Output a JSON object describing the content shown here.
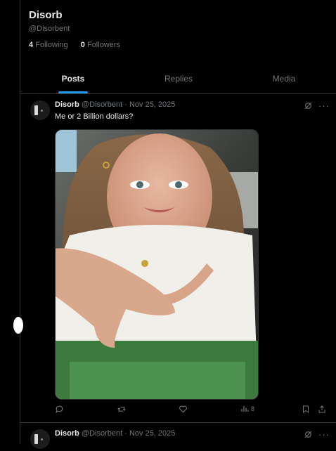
{
  "profile": {
    "name": "Disorb",
    "handle": "@Disorbent",
    "following_count": "4",
    "following_label": "Following",
    "followers_count": "0",
    "followers_label": "Followers"
  },
  "tabs": [
    {
      "label": "Posts",
      "active": true
    },
    {
      "label": "Replies",
      "active": false
    },
    {
      "label": "Media",
      "active": false
    }
  ],
  "posts": [
    {
      "name": "Disorb",
      "handle": "@Disorbent",
      "separator": "·",
      "date": "Nov 25, 2025",
      "text": "Me or 2 Billion dollars?",
      "views": "8",
      "has_image": true
    },
    {
      "name": "Disorb",
      "handle": "@Disorbent",
      "separator": "·",
      "date": "Nov 25, 2025"
    }
  ],
  "icons": [
    "grok-icon",
    "more-icon",
    "reply-icon",
    "retweet-icon",
    "like-icon",
    "views-icon",
    "bookmark-icon",
    "share-icon"
  ],
  "colors": {
    "accent": "#1d9bf0",
    "background": "#000000",
    "muted": "#71767b",
    "border": "#2f3336"
  }
}
